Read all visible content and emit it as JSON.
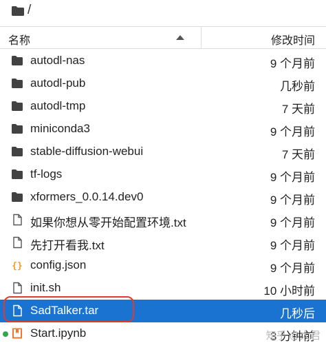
{
  "breadcrumb": {
    "path": "/"
  },
  "header": {
    "name_label": "名称",
    "modified_label": "修改时间"
  },
  "files": [
    {
      "name": "autodl-nas",
      "modified": "9 个月前",
      "type": "folder"
    },
    {
      "name": "autodl-pub",
      "modified": "几秒前",
      "type": "folder"
    },
    {
      "name": "autodl-tmp",
      "modified": "7 天前",
      "type": "folder"
    },
    {
      "name": "miniconda3",
      "modified": "9 个月前",
      "type": "folder"
    },
    {
      "name": "stable-diffusion-webui",
      "modified": "7 天前",
      "type": "folder"
    },
    {
      "name": "tf-logs",
      "modified": "9 个月前",
      "type": "folder"
    },
    {
      "name": "xformers_0.0.14.dev0",
      "modified": "9 个月前",
      "type": "folder"
    },
    {
      "name": "如果你想从零开始配置环境.txt",
      "modified": "9 个月前",
      "type": "file"
    },
    {
      "name": "先打开看我.txt",
      "modified": "9 个月前",
      "type": "file"
    },
    {
      "name": "config.json",
      "modified": "9 个月前",
      "type": "json"
    },
    {
      "name": "init.sh",
      "modified": "10 小时前",
      "type": "file"
    },
    {
      "name": "SadTalker.tar",
      "modified": "几秒后",
      "type": "file",
      "selected": true
    },
    {
      "name": "Start.ipynb",
      "modified": "3 分钟前",
      "type": "notebook",
      "running": true
    }
  ],
  "watermark": "知乎 @大君",
  "colors": {
    "selected": "#1a73d0",
    "folder": "#424242",
    "json": "#f29d2b",
    "notebook": "#f37726",
    "highlight": "#e03a2e",
    "running": "#31a84f"
  }
}
